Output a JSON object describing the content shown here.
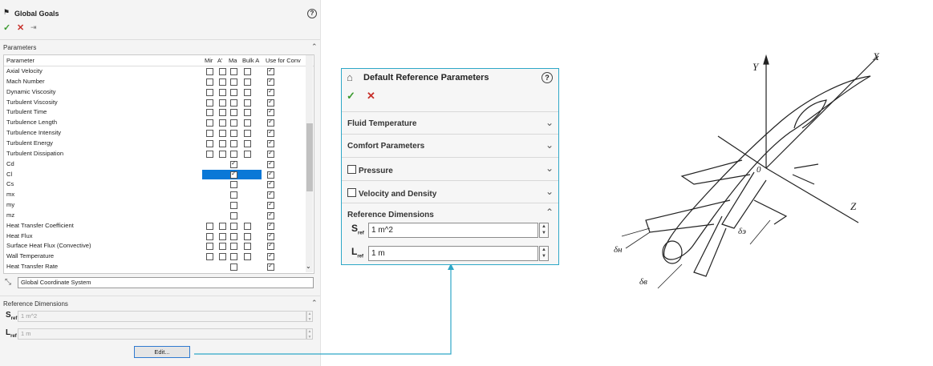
{
  "left_panel": {
    "title": "Global Goals",
    "help": "?",
    "toolbar": {
      "ok": "✓",
      "cancel": "✕",
      "pin": "⇥"
    },
    "parameters_header": "Parameters",
    "table": {
      "columns": [
        "Parameter",
        "Mir",
        "A’",
        "Ma",
        "Bulk A",
        "Use for Conv"
      ],
      "rows": [
        {
          "name": "Axial Velocity",
          "min": false,
          "avg": false,
          "max": false,
          "bulk": false,
          "conv": true
        },
        {
          "name": "Mach Number",
          "min": false,
          "avg": false,
          "max": false,
          "bulk": false,
          "conv": true
        },
        {
          "name": "Dynamic Viscosity",
          "min": false,
          "avg": false,
          "max": false,
          "bulk": false,
          "conv": true
        },
        {
          "name": "Turbulent Viscosity",
          "min": false,
          "avg": false,
          "max": false,
          "bulk": false,
          "conv": true
        },
        {
          "name": "Turbulent Time",
          "min": false,
          "avg": false,
          "max": false,
          "bulk": false,
          "conv": true
        },
        {
          "name": "Turbulence Length",
          "min": false,
          "avg": false,
          "max": false,
          "bulk": false,
          "conv": true
        },
        {
          "name": "Turbulence Intensity",
          "min": false,
          "avg": false,
          "max": false,
          "bulk": false,
          "conv": true
        },
        {
          "name": "Turbulent Energy",
          "min": false,
          "avg": false,
          "max": false,
          "bulk": false,
          "conv": true
        },
        {
          "name": "Turbulent Dissipation",
          "min": false,
          "avg": false,
          "max": false,
          "bulk": false,
          "conv": true
        },
        {
          "name": "Cd",
          "single": true,
          "checked": true,
          "conv": true
        },
        {
          "name": "Cl",
          "single": true,
          "checked": true,
          "conv": true,
          "selected": true
        },
        {
          "name": "Cs",
          "single": true,
          "checked": false,
          "conv": true
        },
        {
          "name": "mx",
          "single": true,
          "checked": false,
          "conv": true
        },
        {
          "name": "my",
          "single": true,
          "checked": false,
          "conv": true
        },
        {
          "name": "mz",
          "single": true,
          "checked": false,
          "conv": true
        },
        {
          "name": "Heat Transfer Coefficient",
          "min": false,
          "avg": false,
          "max": false,
          "bulk": false,
          "conv": true
        },
        {
          "name": "Heat Flux",
          "min": false,
          "avg": false,
          "max": false,
          "bulk": false,
          "conv": true
        },
        {
          "name": "Surface Heat Flux (Convective)",
          "min": false,
          "avg": false,
          "max": false,
          "bulk": false,
          "conv": true
        },
        {
          "name": "Wall Temperature",
          "min": false,
          "avg": false,
          "max": false,
          "bulk": false,
          "conv": true
        },
        {
          "name": "Heat Transfer Rate",
          "single": true,
          "checked": false,
          "conv": true
        }
      ]
    },
    "coordinate_system": "Global Coordinate System",
    "ref_dims_header": "Reference Dimensions",
    "s_ref_value": "1 m^2",
    "l_ref_value": "1 m",
    "s_label": "S",
    "l_label": "L",
    "sub": "ref",
    "edit_label": "Edit..."
  },
  "popup": {
    "title": "Default Reference Parameters",
    "help": "?",
    "sections": {
      "fluid_temperature": "Fluid Temperature",
      "comfort": "Comfort Parameters",
      "pressure": "Pressure",
      "velocity_density": "Velocity and Density",
      "reference_dimensions": "Reference Dimensions"
    },
    "s_ref_value": "1 m^2",
    "l_ref_value": "1 m",
    "s_label": "S",
    "l_label": "L",
    "sub": "ref"
  },
  "sketch": {
    "labels": {
      "y": "Y",
      "x": "X",
      "z": "Z",
      "origin": "0",
      "d_n": "δн",
      "d_e": "δэ",
      "d_v": "δв"
    }
  },
  "colors": {
    "accent": "#2ea7c7",
    "selection": "#0a78d7",
    "ok": "#3a9a2e",
    "cancel": "#c7302a"
  }
}
